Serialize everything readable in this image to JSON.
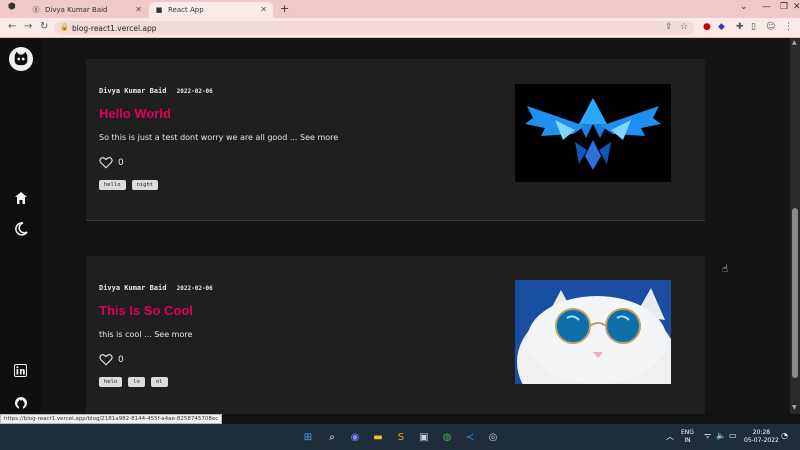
{
  "browser": {
    "tabs": [
      {
        "label": "Divya Kumar Baid",
        "active": false
      },
      {
        "label": "React App",
        "active": true
      }
    ],
    "url": "blog-react1.vercel.app",
    "status_url": "https://blog-react1.vercel.app/blog/2181a982-8144-455f-a4ae-8258745708ec"
  },
  "sidebar": {
    "items": [
      {
        "icon": "cat-logo-icon"
      },
      {
        "icon": "home-icon"
      },
      {
        "icon": "moon-icon"
      },
      {
        "icon": "linkedin-icon"
      },
      {
        "icon": "github-icon"
      }
    ]
  },
  "posts": [
    {
      "author": "Divya Kumar Baid",
      "date": "2022-02-06",
      "title": "Hello World",
      "excerpt": "So this is just a test dont worry we are all good ... See more",
      "likes": "0",
      "tags": [
        "hello",
        "night"
      ],
      "image": "winged-triforce-artwork"
    },
    {
      "author": "Divya Kumar Baid",
      "date": "2022-02-06",
      "title": "This Is So Cool",
      "excerpt": "this is cool ... See more",
      "likes": "0",
      "tags": [
        "helo",
        "lo",
        "ol"
      ],
      "image": "cat-with-sunglasses-photo"
    }
  ],
  "taskbar": {
    "lang": "ENG",
    "region": "IN",
    "time": "20:28",
    "date": "05-07-2022"
  },
  "colors": {
    "accent": "#e0005a",
    "background": "#141414",
    "card": "#1f1f1f",
    "tab_bar": "#f0c8c8"
  }
}
